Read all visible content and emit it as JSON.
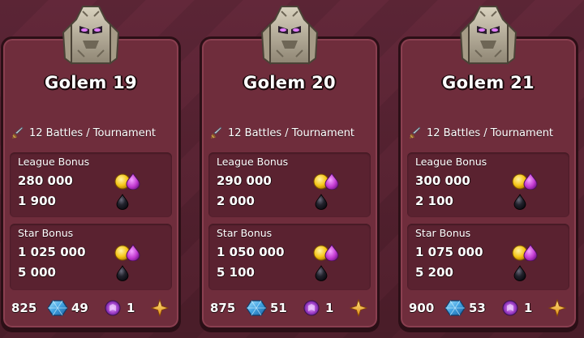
{
  "cards": [
    {
      "title": "Golem 19",
      "battles": "12 Battles / Tournament",
      "league_label": "League Bonus",
      "league_gold_elixir": "280 000",
      "league_dark": "1 900",
      "star_label": "Star Bonus",
      "star_gold_elixir": "1 025 000",
      "star_dark": "5 000",
      "xp": "825",
      "gems": "49",
      "books": "1"
    },
    {
      "title": "Golem 20",
      "battles": "12 Battles / Tournament",
      "league_label": "League Bonus",
      "league_gold_elixir": "290 000",
      "league_dark": "2 000",
      "star_label": "Star Bonus",
      "star_gold_elixir": "1 050 000",
      "star_dark": "5 100",
      "xp": "875",
      "gems": "51",
      "books": "1"
    },
    {
      "title": "Golem 21",
      "battles": "12 Battles / Tournament",
      "league_label": "League Bonus",
      "league_gold_elixir": "300 000",
      "league_dark": "2 100",
      "star_label": "Star Bonus",
      "star_gold_elixir": "1 075 000",
      "star_dark": "5 200",
      "xp": "900",
      "gems": "53",
      "books": "1"
    }
  ],
  "colors": {
    "background": "#5a2530",
    "card": "#6f2d3c",
    "panel": "#5a2230",
    "gold": "#f5c518",
    "elixir": "#c23ad1",
    "dark_elixir": "#1a1a22",
    "gem": "#3fa0e0"
  },
  "icons": [
    "golem-icon",
    "sword-icon",
    "gold-coin-icon",
    "elixir-drop-icon",
    "dark-elixir-icon",
    "gem-icon",
    "magic-book-icon",
    "star-icon"
  ]
}
